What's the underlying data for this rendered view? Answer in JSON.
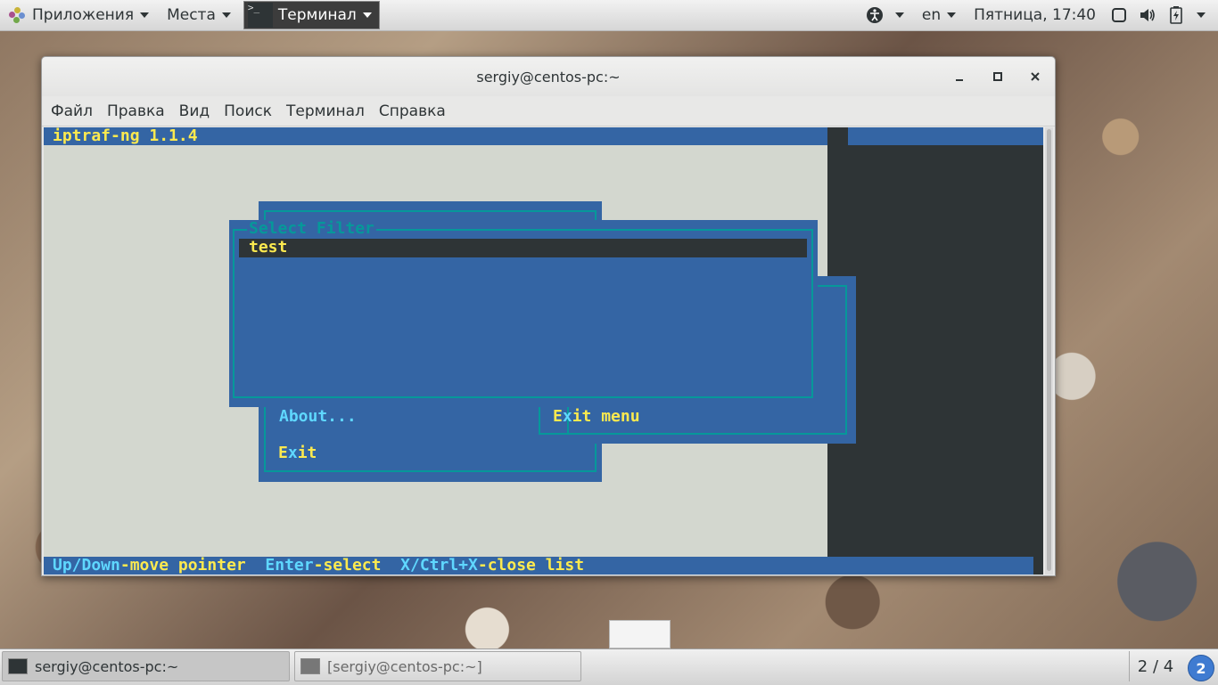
{
  "topbar": {
    "apps": "Приложения",
    "places": "Места",
    "terminal_app": "Терминал",
    "lang": "en",
    "datetime": "Пятница, 17:40"
  },
  "window": {
    "title": "sergiy@centos-pc:~",
    "menu": [
      "Файл",
      "Правка",
      "Вид",
      "Поиск",
      "Терминал",
      "Справка"
    ]
  },
  "terminal": {
    "app_header": "iptraf-ng 1.1.4",
    "select_filter_title": "Select Filter",
    "filter_items": [
      "test"
    ],
    "menu_about": "About...",
    "menu_exit_menu_pre": "E",
    "menu_exit_menu_hot": "x",
    "menu_exit_menu_post": "it menu",
    "menu_exit_pre": "E",
    "menu_exit_hot": "x",
    "menu_exit_post": "it",
    "footer": {
      "k1": "Up/Down",
      "d1": "-move pointer  ",
      "k2": "Enter",
      "d2": "-select  ",
      "k3": "X/Ctrl+X",
      "d3": "-close list"
    }
  },
  "taskbar": {
    "task1": "sergiy@centos-pc:~",
    "task2": "[sergiy@centos-pc:~]",
    "workspace": "2 / 4",
    "notifications": "2"
  },
  "colors": {
    "term_blue": "#3465a4",
    "term_yellow": "#fce94f",
    "term_cyan": "#06989a",
    "term_bg": "#2e3436"
  }
}
